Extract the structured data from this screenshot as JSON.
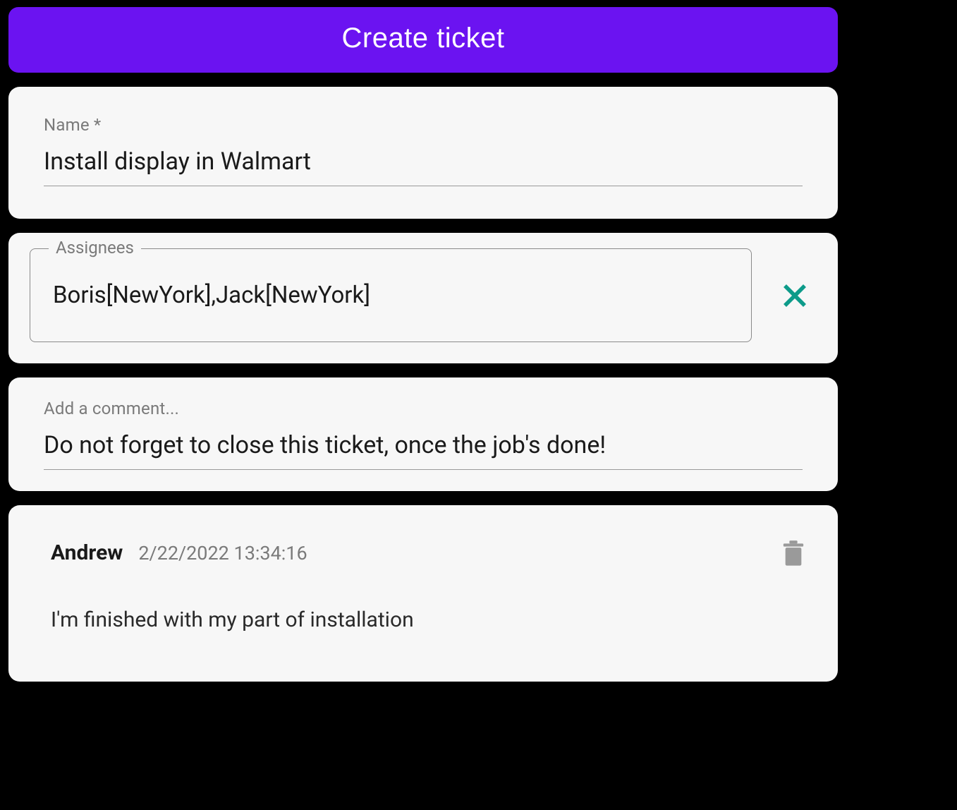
{
  "header": {
    "create_btn_label": "Create ticket"
  },
  "name_field": {
    "label": "Name *",
    "value": "Install display in Walmart"
  },
  "assignees_field": {
    "label": "Assignees",
    "value": "Boris[NewYork],Jack[NewYork]"
  },
  "comment_input": {
    "label": "Add a comment...",
    "value": "Do not forget to close this ticket, once the job's done!"
  },
  "comments": [
    {
      "author": "Andrew",
      "timestamp": "2/22/2022 13:34:16",
      "body": "I'm finished with my part of installation"
    }
  ],
  "colors": {
    "primary": "#6b13f1",
    "accent_teal": "#0d9b8a",
    "card_bg": "#f7f7f7",
    "muted_text": "#7a7a7a"
  }
}
